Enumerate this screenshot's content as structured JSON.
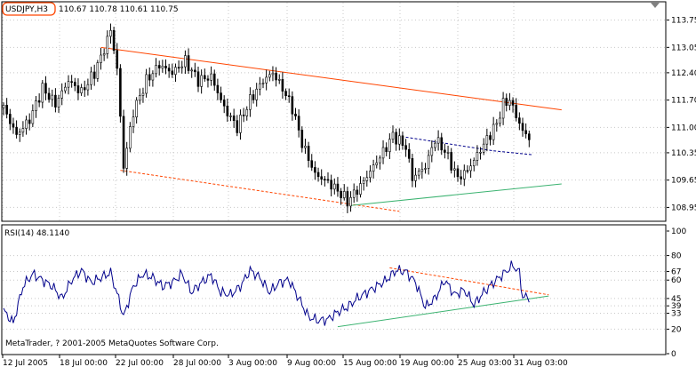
{
  "window": {
    "symbol_label": "USDJPY,H3",
    "ohlc_label": "110.67 110.78 110.61 110.75",
    "rsi_label": "RSI(14) 48.1140",
    "copyright": "MetaTrader, ? 2001-2005 MetaQuotes Software Corp."
  },
  "colors": {
    "background": "#ffffff",
    "border": "#000000",
    "grid": "#c8c8c8",
    "candle": "#000000",
    "resistance": "#ff4500",
    "support": "#3cb371",
    "channel": "#00008b",
    "rsi_line": "#00008b",
    "symbol_badge": "#ff4500",
    "scale_marker": "#808080"
  },
  "chart_data": [
    {
      "type": "candlestick",
      "title": "USDJPY,H3",
      "x_tick_labels": [
        "12 Jul 2005",
        "18 Jul 00:00",
        "22 Jul 00:00",
        "28 Jul 00:00",
        "3 Aug 00:00",
        "9 Aug 00:00",
        "15 Aug 00:00",
        "19 Aug 00:00",
        "25 Aug 03:00",
        "31 Aug 03:00"
      ],
      "y_ticks": [
        113.75,
        113.05,
        112.4,
        111.7,
        111.0,
        110.35,
        109.65,
        108.95
      ],
      "ylim": [
        108.8,
        113.9
      ],
      "grid": true,
      "close_path": [
        [
          0,
          111.5
        ],
        [
          4,
          110.8
        ],
        [
          8,
          111.2
        ],
        [
          12,
          112.0
        ],
        [
          16,
          111.6
        ],
        [
          20,
          112.2
        ],
        [
          24,
          111.9
        ],
        [
          28,
          112.4
        ],
        [
          31,
          113.0
        ],
        [
          33,
          113.5
        ],
        [
          35,
          112.5
        ],
        [
          37,
          110.0
        ],
        [
          40,
          111.4
        ],
        [
          44,
          112.2
        ],
        [
          48,
          112.6
        ],
        [
          52,
          112.4
        ],
        [
          56,
          112.7
        ],
        [
          60,
          112.2
        ],
        [
          64,
          112.3
        ],
        [
          68,
          111.5
        ],
        [
          72,
          111.0
        ],
        [
          76,
          111.7
        ],
        [
          80,
          112.2
        ],
        [
          83,
          112.4
        ],
        [
          86,
          112.0
        ],
        [
          89,
          111.5
        ],
        [
          92,
          110.6
        ],
        [
          96,
          109.8
        ],
        [
          100,
          109.6
        ],
        [
          104,
          109.3
        ],
        [
          106,
          109.1
        ],
        [
          110,
          109.5
        ],
        [
          114,
          110.0
        ],
        [
          118,
          110.5
        ],
        [
          120,
          110.8
        ],
        [
          124,
          110.5
        ],
        [
          126,
          109.7
        ],
        [
          130,
          110.0
        ],
        [
          133,
          110.7
        ],
        [
          136,
          110.4
        ],
        [
          140,
          109.7
        ],
        [
          143,
          109.9
        ],
        [
          146,
          110.3
        ],
        [
          149,
          110.7
        ],
        [
          152,
          111.1
        ],
        [
          154,
          111.6
        ],
        [
          156,
          111.7
        ],
        [
          158,
          111.3
        ],
        [
          160,
          110.9
        ],
        [
          162,
          110.75
        ]
      ],
      "trendlines": [
        {
          "name": "resistance",
          "style": "solid",
          "color": "#ff4500",
          "from": [
            30,
            113.05
          ],
          "to": [
            172,
            111.45
          ]
        },
        {
          "name": "lower-channel",
          "style": "dashed",
          "color": "#ff4500",
          "from": [
            36,
            109.9
          ],
          "to": [
            122,
            108.85
          ]
        },
        {
          "name": "support",
          "style": "solid",
          "color": "#3cb371",
          "from": [
            107,
            109.0
          ],
          "to": [
            172,
            109.55
          ]
        },
        {
          "name": "channel-top",
          "style": "dashed",
          "color": "#00008b",
          "from": [
            124,
            110.75
          ],
          "to": [
            151,
            110.4
          ]
        },
        {
          "name": "channel-bottom",
          "style": "dashed",
          "color": "#00008b",
          "from": [
            151,
            110.4
          ],
          "to": [
            163,
            110.3
          ]
        }
      ]
    },
    {
      "type": "line",
      "title": "RSI(14) 48.1140",
      "y_ticks": [
        100,
        80,
        67,
        60,
        45,
        39,
        33,
        20,
        0
      ],
      "ylim": [
        0,
        100
      ],
      "grid": true,
      "series": [
        {
          "name": "RSI(14)",
          "x": [
            0,
            3,
            6,
            9,
            12,
            15,
            18,
            21,
            24,
            27,
            30,
            33,
            36,
            37,
            40,
            43,
            46,
            49,
            52,
            55,
            58,
            61,
            64,
            67,
            70,
            73,
            76,
            79,
            82,
            85,
            88,
            91,
            94,
            97,
            100,
            103,
            106,
            109,
            112,
            115,
            118,
            121,
            124,
            127,
            130,
            133,
            136,
            139,
            142,
            145,
            148,
            151,
            154,
            157,
            159,
            160
          ],
          "values": [
            35,
            25,
            55,
            65,
            60,
            55,
            45,
            60,
            68,
            58,
            62,
            66,
            40,
            30,
            55,
            65,
            62,
            55,
            58,
            65,
            50,
            58,
            64,
            50,
            48,
            55,
            68,
            62,
            50,
            58,
            60,
            45,
            30,
            27,
            28,
            34,
            38,
            45,
            50,
            55,
            60,
            68,
            67,
            58,
            38,
            45,
            60,
            48,
            52,
            40,
            50,
            58,
            65,
            72,
            66,
            46
          ]
        }
      ],
      "trendlines": [
        {
          "name": "rsi-resistance",
          "style": "dashed",
          "color": "#ff4500",
          "from": [
            119,
            70
          ],
          "to": [
            168,
            48
          ]
        },
        {
          "name": "rsi-support",
          "style": "solid",
          "color": "#3cb371",
          "from": [
            103,
            22
          ],
          "to": [
            168,
            47
          ]
        }
      ]
    }
  ]
}
